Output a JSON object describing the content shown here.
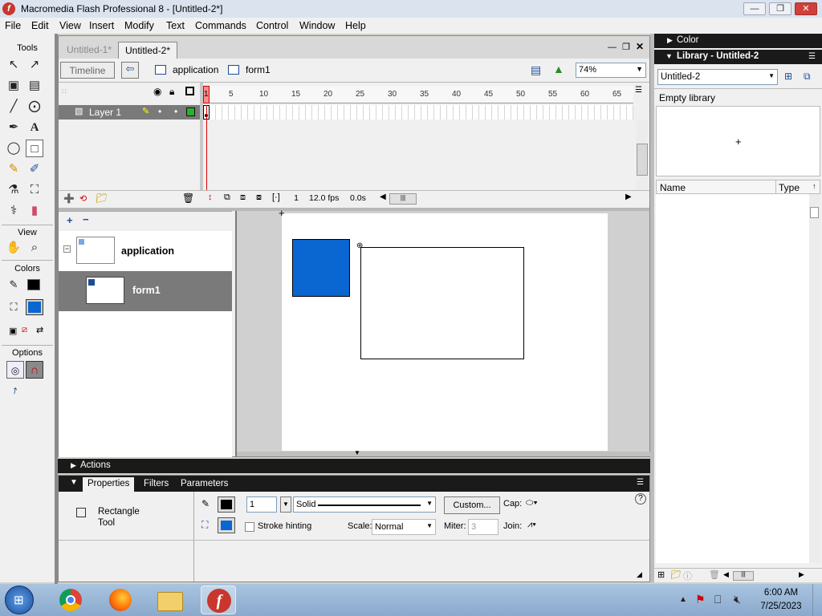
{
  "window": {
    "title": "Macromedia Flash Professional 8 - [Untitled-2*]",
    "minimize": "—",
    "restore": "❐",
    "close": "✕"
  },
  "menu": [
    "File",
    "Edit",
    "View",
    "Insert",
    "Modify",
    "Text",
    "Commands",
    "Control",
    "Window",
    "Help"
  ],
  "tools": {
    "header": "Tools",
    "view_header": "View",
    "colors_header": "Colors",
    "options_header": "Options"
  },
  "document": {
    "tabs": [
      {
        "label": "Untitled-1*",
        "active": false
      },
      {
        "label": "Untitled-2*",
        "active": true
      }
    ],
    "timeline_button": "Timeline",
    "breadcrumb": [
      "application",
      "form1"
    ],
    "zoom": "74%"
  },
  "timeline": {
    "ruler": [
      "1",
      "5",
      "10",
      "15",
      "20",
      "25",
      "30",
      "35",
      "40",
      "45",
      "50",
      "55",
      "60",
      "65"
    ],
    "layer": "Layer 1",
    "current_frame": "1",
    "fps": "12.0 fps",
    "time": "0.0s"
  },
  "screens": {
    "items": [
      {
        "label": "application",
        "selected": false
      },
      {
        "label": "form1",
        "selected": true
      }
    ]
  },
  "panels": {
    "actions": "Actions"
  },
  "properties": {
    "tabs": [
      "Properties",
      "Filters",
      "Parameters"
    ],
    "tool_name": "Rectangle Tool",
    "stroke_width": "1",
    "stroke_style": "Solid",
    "custom_button": "Custom...",
    "cap_label": "Cap:",
    "stroke_hinting": "Stroke hinting",
    "scale_label": "Scale:",
    "scale_value": "Normal",
    "miter_label": "Miter:",
    "miter_value": "3",
    "join_label": "Join:",
    "help": "?"
  },
  "right": {
    "color_header": "Color",
    "library_header": "Library - Untitled-2",
    "library_select": "Untitled-2",
    "empty_library": "Empty library",
    "col_name": "Name",
    "col_type": "Type"
  },
  "taskbar": {
    "time": "6:00 AM",
    "date": "7/25/2023"
  },
  "colors": {
    "fill": "#0a66d0",
    "stroke": "#000000"
  }
}
